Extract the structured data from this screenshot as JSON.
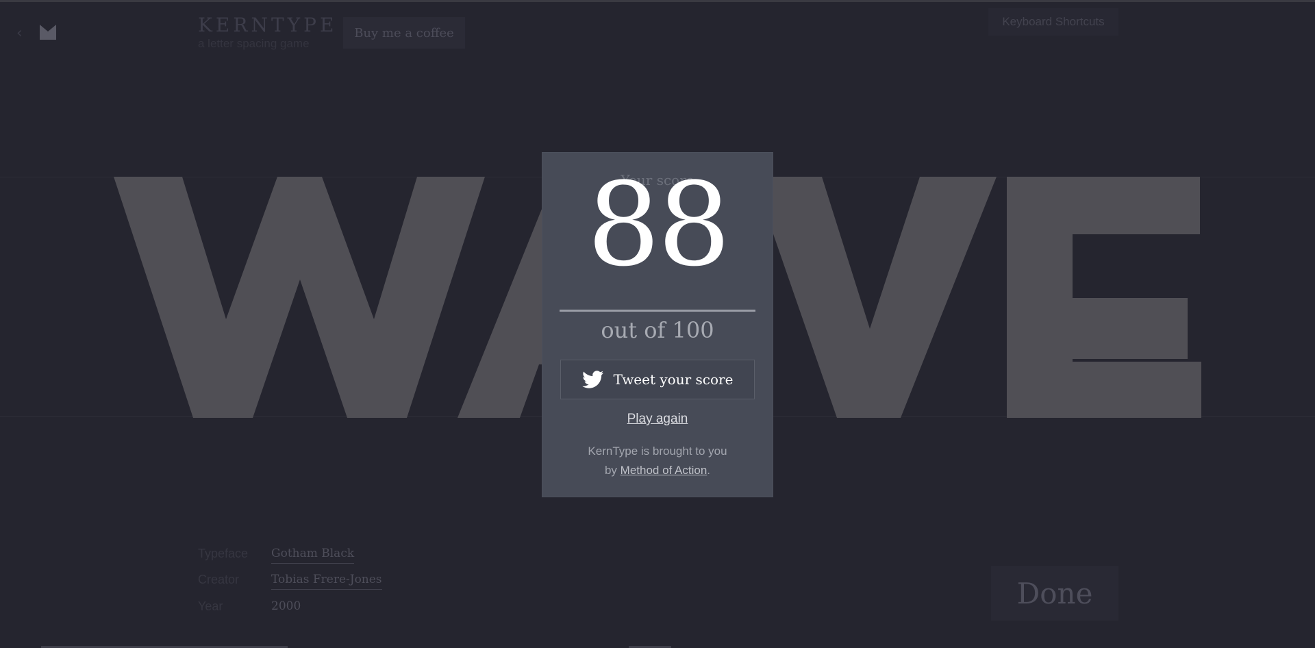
{
  "header": {
    "brand_title": "KERNTYPE",
    "brand_subtitle": "a letter spacing game",
    "coffee_label": "Buy me a coffee",
    "shortcuts_label": "Keyboard Shortcuts"
  },
  "word": {
    "letters": [
      "W",
      "A",
      "V",
      "E"
    ]
  },
  "modal": {
    "label": "Your score",
    "score": "88",
    "out_of": "out of 100",
    "tweet_label": "Tweet your score",
    "play_again": "Play again",
    "credit_prefix": "KernType is brought to you",
    "credit_by": "by",
    "credit_link": "Method of Action",
    "credit_suffix": "."
  },
  "info": {
    "typeface_label": "Typeface",
    "typeface_value": "Gotham Black",
    "creator_label": "Creator",
    "creator_value": "Tobias Frere-Jones",
    "year_label": "Year",
    "year_value": "2000"
  },
  "done_label": "Done",
  "colors": {
    "background": "#25252f",
    "letter_fill": "#504f55",
    "modal_bg": "#474b57",
    "score_text": "#ffffff"
  },
  "icons": [
    "back-chevron-icon",
    "method-of-action-logo-icon",
    "twitter-bird-icon"
  ]
}
